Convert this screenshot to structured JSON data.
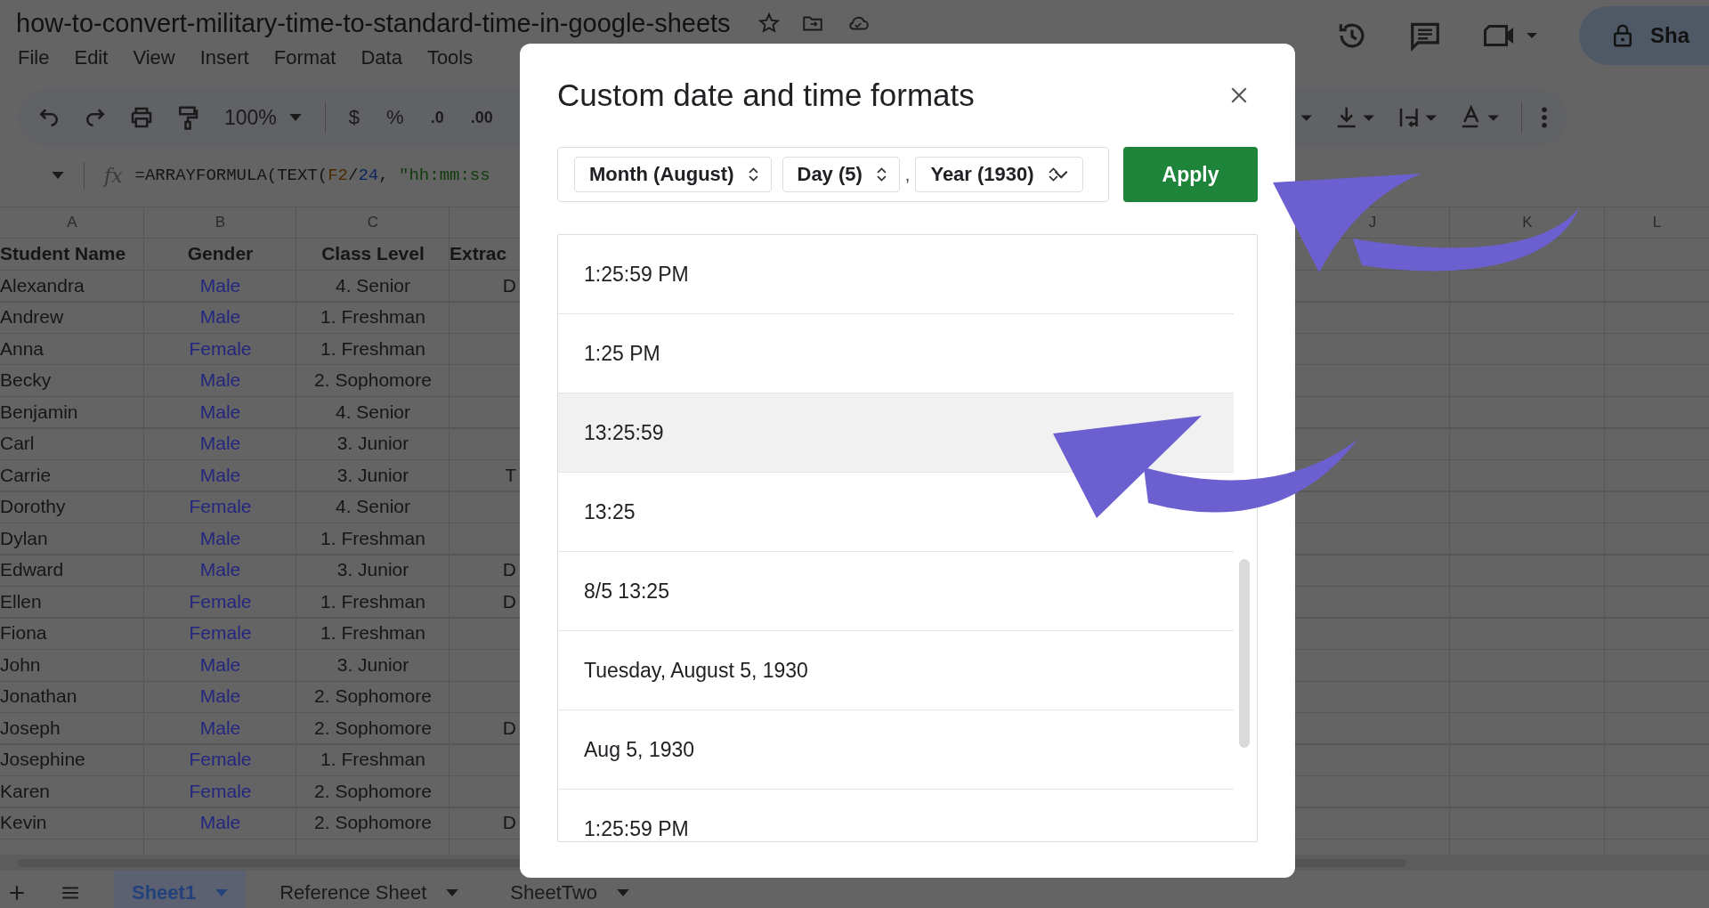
{
  "document": {
    "title": "how-to-convert-military-time-to-standard-time-in-google-sheets"
  },
  "menu": [
    "File",
    "Edit",
    "View",
    "Insert",
    "Format",
    "Data",
    "Tools"
  ],
  "share_button": {
    "label": "Sha"
  },
  "toolbar": {
    "zoom": "100%",
    "currency": "$",
    "percent": "%",
    "decrease_decimals": ".0",
    "increase_decimals": ".00"
  },
  "formula_bar": {
    "fx_label": "fx",
    "segments": [
      {
        "kind": "plain",
        "text": "=ARRAYFORMULA(TEXT("
      },
      {
        "kind": "ref",
        "text": "F2"
      },
      {
        "kind": "plain",
        "text": "/"
      },
      {
        "kind": "number",
        "text": "24"
      },
      {
        "kind": "plain",
        "text": ", "
      },
      {
        "kind": "string",
        "text": "\"hh:mm:ss"
      }
    ]
  },
  "sheet": {
    "column_letters": [
      "A",
      "B",
      "C"
    ],
    "right_column_letters": [
      "J",
      "K",
      "L"
    ],
    "header": [
      "Student Name",
      "Gender",
      "Class Level",
      "Extrac"
    ],
    "rows": [
      [
        "Alexandra",
        "Male",
        "4. Senior",
        "D"
      ],
      [
        "Andrew",
        "Male",
        "1. Freshman",
        ""
      ],
      [
        "Anna",
        "Female",
        "1. Freshman",
        ""
      ],
      [
        "Becky",
        "Male",
        "2. Sophomore",
        ""
      ],
      [
        "Benjamin",
        "Male",
        "4. Senior",
        ""
      ],
      [
        "Carl",
        "Male",
        "3. Junior",
        ""
      ],
      [
        "Carrie",
        "Male",
        "3. Junior",
        "T"
      ],
      [
        "Dorothy",
        "Female",
        "4. Senior",
        ""
      ],
      [
        "Dylan",
        "Male",
        "1. Freshman",
        ""
      ],
      [
        "Edward",
        "Male",
        "3. Junior",
        "D"
      ],
      [
        "Ellen",
        "Female",
        "1. Freshman",
        "D"
      ],
      [
        "Fiona",
        "Female",
        "1. Freshman",
        ""
      ],
      [
        "John",
        "Male",
        "3. Junior",
        ""
      ],
      [
        "Jonathan",
        "Male",
        "2. Sophomore",
        ""
      ],
      [
        "Joseph",
        "Male",
        "2. Sophomore",
        "D"
      ],
      [
        "Josephine",
        "Female",
        "1. Freshman",
        ""
      ],
      [
        "Karen",
        "Female",
        "2. Sophomore",
        ""
      ],
      [
        "Kevin",
        "Male",
        "2. Sophomore",
        "D"
      ]
    ]
  },
  "sheet_tabs": [
    {
      "label": "Sheet1",
      "selected": true
    },
    {
      "label": "Reference Sheet",
      "selected": false
    },
    {
      "label": "SheetTwo",
      "selected": false
    }
  ],
  "dialog": {
    "title": "Custom date and time formats",
    "chips": [
      {
        "kind": "select",
        "label": "Month (August)"
      },
      {
        "kind": "select",
        "label": "Day (5)"
      },
      {
        "kind": "separator",
        "label": ","
      },
      {
        "kind": "select_open",
        "label": "Year (1930)"
      }
    ],
    "apply": "Apply",
    "formats": [
      {
        "label": "1:25:59 PM",
        "selected": false
      },
      {
        "label": "1:25 PM",
        "selected": false
      },
      {
        "label": "13:25:59",
        "selected": true
      },
      {
        "label": "13:25",
        "selected": false
      },
      {
        "label": "8/5 13:25",
        "selected": false
      },
      {
        "label": "Tuesday, August 5, 1930",
        "selected": false
      },
      {
        "label": "Aug 5, 1930",
        "selected": false
      },
      {
        "label": "1:25:59 PM",
        "selected": false
      }
    ]
  }
}
